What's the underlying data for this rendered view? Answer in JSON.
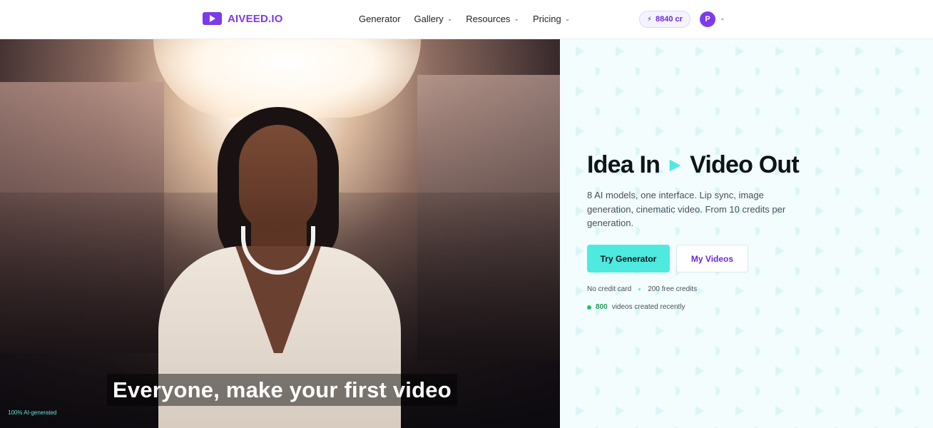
{
  "header": {
    "logo_text": "AIVEED.IO",
    "nav": [
      {
        "label": "Generator",
        "dropdown": false
      },
      {
        "label": "Gallery",
        "dropdown": true
      },
      {
        "label": "Resources",
        "dropdown": true
      },
      {
        "label": "Pricing",
        "dropdown": true
      }
    ],
    "credits": "8840 cr",
    "avatar_initial": "P"
  },
  "video": {
    "caption": "Everyone, make your first video",
    "ai_label": "100% AI-generated"
  },
  "hero": {
    "title_left": "Idea In",
    "title_right": "Video Out",
    "subtitle": "8 AI models, one interface. Lip sync, image generation, cinematic video. From 10 credits per generation.",
    "primary_button": "Try Generator",
    "secondary_button": "My Videos",
    "meta_left": "No credit card",
    "meta_right": "200 free credits",
    "videos_count": "800",
    "videos_text": "videos created recently"
  },
  "colors": {
    "brand": "#7c3aed",
    "accent": "#4eeadf",
    "hero_bg": "#f3fdfd",
    "live": "#22c55e"
  }
}
